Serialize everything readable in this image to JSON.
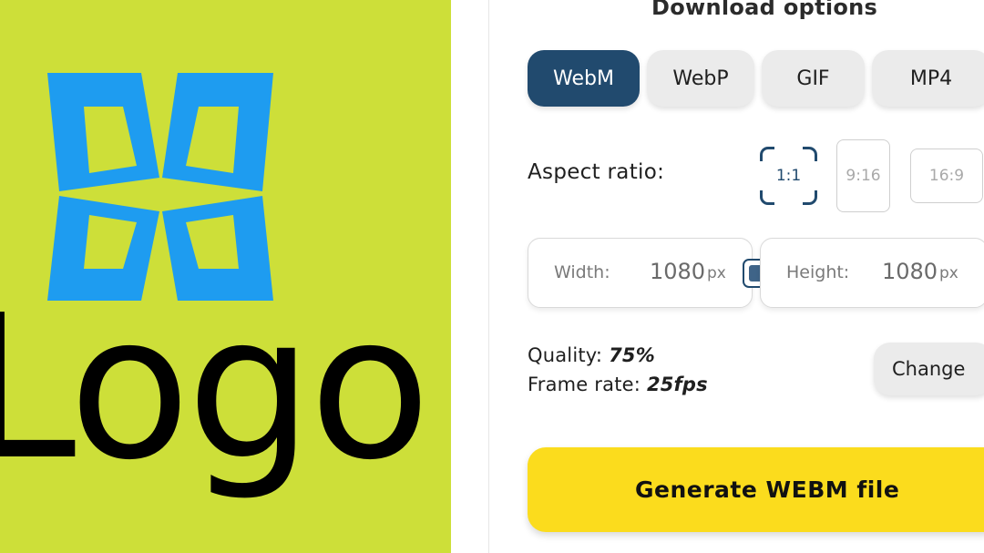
{
  "preview": {
    "logo_text": "Logo",
    "background_color": "#cddf39",
    "mark_color": "#1e9cf0",
    "text_color": "#000000",
    "mark_icon": "four-petal-star-icon"
  },
  "panel": {
    "title": "Download options",
    "formats": [
      {
        "label": "WebM",
        "active": true
      },
      {
        "label": "WebP",
        "active": false
      },
      {
        "label": "GIF",
        "active": false
      },
      {
        "label": "MP4",
        "active": false
      }
    ],
    "aspect_label": "Aspect ratio:",
    "aspect_ratios": [
      {
        "label": "1:1",
        "active": true
      },
      {
        "label": "9:16",
        "active": false
      },
      {
        "label": "16:9",
        "active": false
      }
    ],
    "width": {
      "label": "Width:",
      "value": "1080",
      "unit": "px"
    },
    "height": {
      "label": "Height:",
      "value": "1080",
      "unit": "px"
    },
    "lock_icon": "aspect-lock-icon",
    "quality_label": "Quality:",
    "quality_value": "75%",
    "framerate_label": "Frame rate:",
    "framerate_value": "25fps",
    "change_label": "Change",
    "generate_label": "Generate WEBM file"
  },
  "colors": {
    "accent_dark": "#214a6e",
    "button_gray": "#ebebeb",
    "generate_yellow": "#fbdc1d"
  }
}
